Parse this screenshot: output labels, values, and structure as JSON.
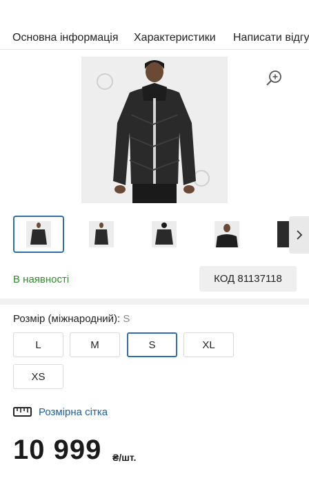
{
  "tabs": [
    {
      "label": "Основна інформація"
    },
    {
      "label": "Характеристики"
    },
    {
      "label": "Написати відгук"
    }
  ],
  "product": {
    "availability": "В наявності",
    "code": "КОД 81137118",
    "size_label": "Розмір (міжнародний):",
    "selected_size": "S",
    "sizes": [
      "L",
      "M",
      "S",
      "XL",
      "XS"
    ],
    "size_chart_link": "Розмірна сітка",
    "price": "10 999",
    "price_unit": "₴/шт."
  },
  "icons": {
    "zoom": "zoom-in-icon",
    "next": "chevron-right-icon",
    "ruler": "ruler-icon"
  },
  "colors": {
    "accent": "#2e6fa8",
    "in_stock": "#2f8a2b",
    "link": "#1f5f9a"
  }
}
